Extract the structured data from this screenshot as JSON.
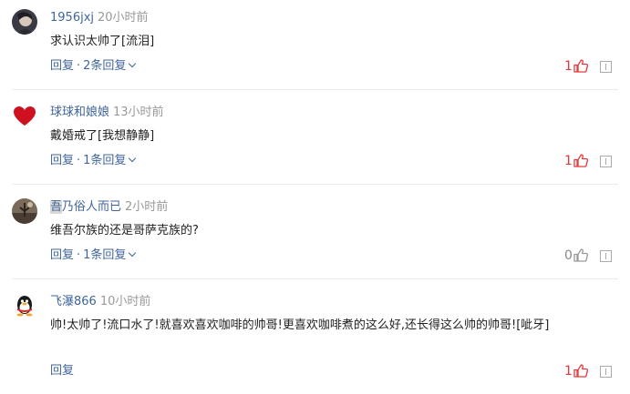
{
  "comments": [
    {
      "username": "1956jxj",
      "time": "20小时前",
      "text": "求认识太帅了[流泪]",
      "reply_label": "回复",
      "reply_count_label": "2条回复",
      "likes": "1"
    },
    {
      "username": "球球和娘娘",
      "time": "13小时前",
      "text": "戴婚戒了[我想静静]",
      "reply_label": "回复",
      "reply_count_label": "1条回复",
      "likes": "1"
    },
    {
      "username_highlight": "吾",
      "username_rest": "乃俗人而已",
      "time": "2小时前",
      "text": "维吾尔族的还是哥萨克族的?",
      "reply_label": "回复",
      "reply_count_label": "1条回复",
      "likes": "0"
    },
    {
      "username": "飞瀑866",
      "time": "10小时前",
      "text": "帅!太帅了!流口水了!就喜欢喜欢咖啡的帅哥!更喜欢咖啡煮的这么好,还长得这么帅的帅哥![呲牙]",
      "reply_label": "回复",
      "likes": "1"
    }
  ],
  "icons": {
    "like": "thumbs-up-icon",
    "report": "report-icon",
    "expand": "chevron-down-icon"
  },
  "colors": {
    "link": "#406599",
    "like_active": "#e4393c",
    "muted": "#999999"
  }
}
